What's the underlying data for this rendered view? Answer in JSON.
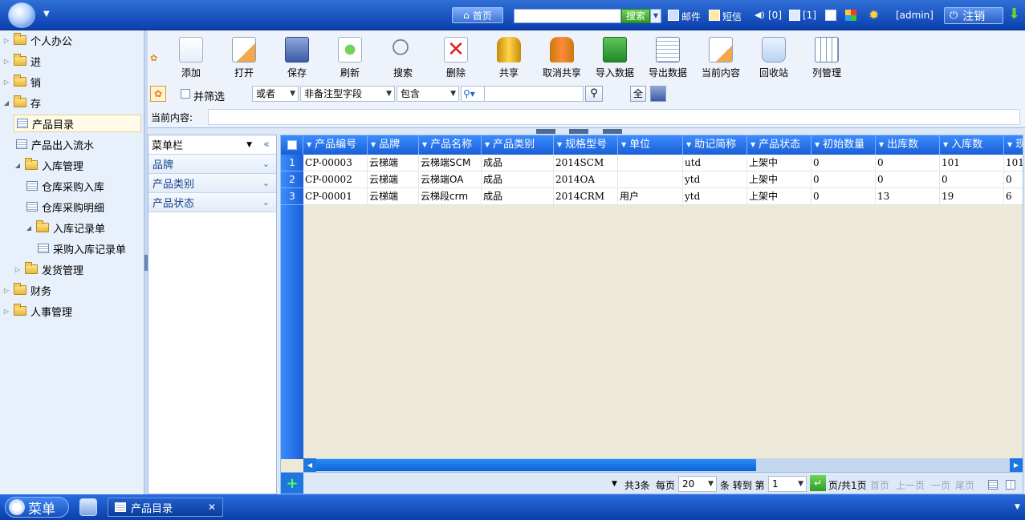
{
  "topbar": {
    "home_label": "首页",
    "search_placeholder": "",
    "search_label": "搜索",
    "mail_label": "邮件",
    "sms_label": "短信",
    "notice_count": "[0]",
    "task_count": "[1]",
    "user_label": "[admin]",
    "logout_label": "注销"
  },
  "tree": {
    "items": [
      {
        "label": "个人办公"
      },
      {
        "label": "进"
      },
      {
        "label": "销"
      },
      {
        "label": "存"
      },
      {
        "label": "产品目录"
      },
      {
        "label": "产品出入流水"
      },
      {
        "label": "入库管理"
      },
      {
        "label": "仓库采购入库"
      },
      {
        "label": "仓库采购明细"
      },
      {
        "label": "入库记录单"
      },
      {
        "label": "采购入库记录单"
      },
      {
        "label": "发货管理"
      },
      {
        "label": "财务"
      },
      {
        "label": "人事管理"
      }
    ]
  },
  "toolbar": {
    "add": "添加",
    "open": "打开",
    "save": "保存",
    "refresh": "刷新",
    "search": "搜索",
    "delete": "删除",
    "share": "共享",
    "unshare": "取消共享",
    "import": "导入数据",
    "export": "导出数据",
    "current": "当前内容",
    "recycle": "回收站",
    "columns": "列管理"
  },
  "filter": {
    "and_filter_label": "并筛选",
    "logic": "或者",
    "field": "非备注型字段",
    "operator": "包含",
    "value": "",
    "all_label": "全"
  },
  "current_content_label": "当前内容:",
  "menu_panel": {
    "title": "菜单栏",
    "sections": [
      "品牌",
      "产品类别",
      "产品状态"
    ]
  },
  "grid": {
    "columns": [
      "产品编号",
      "品牌",
      "产品名称",
      "产品类别",
      "规格型号",
      "单位",
      "助记简称",
      "产品状态",
      "初始数量",
      "出库数",
      "入库数",
      "现"
    ],
    "rows": [
      {
        "num": "1",
        "cells": [
          "CP-00003",
          "云梯端",
          "云梯端SCM",
          "成品",
          "2014SCM",
          "",
          "utd",
          "上架中",
          "0",
          "0",
          "101",
          "101"
        ]
      },
      {
        "num": "2",
        "cells": [
          "CP-00002",
          "云梯端",
          "云梯端OA",
          "成品",
          "2014OA",
          "",
          "ytd",
          "上架中",
          "0",
          "0",
          "0",
          "0"
        ]
      },
      {
        "num": "3",
        "cells": [
          "CP-00001",
          "云梯端",
          "云梯段crm",
          "成品",
          "2014CRM",
          "用户",
          "ytd",
          "上架中",
          "0",
          "13",
          "19",
          "6"
        ]
      }
    ]
  },
  "pager": {
    "total": "共3条",
    "per_page_label": "每页",
    "per_page": "20",
    "goto_label": "条 转到 第",
    "page": "1",
    "page_info": "页/共1页",
    "first": "首页",
    "prev": "上一页",
    "next": "一页",
    "last": "尾页"
  },
  "taskbar": {
    "menu_label": "菜单",
    "tab_label": "产品目录"
  }
}
